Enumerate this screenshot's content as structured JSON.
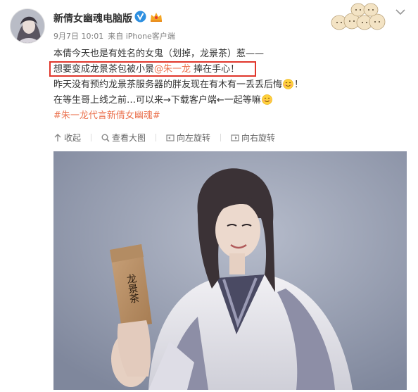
{
  "post": {
    "author": "新倩女幽魂电脑版",
    "date": "9月7日 10:01",
    "source": "来自 iPhone客户端",
    "lines": [
      "本倩今天也是有姓名的女鬼（划掉，龙景茶）惹——",
      "想要变成龙景茶包被小景",
      "@朱一龙",
      " 捧在手心！",
      "昨天没有预约龙景茶服务器的胖友现在有木有一丢丢后悔",
      "！",
      "在等生哥上线之前…可以来→下载客户端←一起等嘛",
      "#朱一龙代言新倩女幽魂#"
    ]
  },
  "toolbar": {
    "collapse": "收起",
    "view_large": "查看大图",
    "rotate_left": "向左旋转",
    "rotate_right": "向右旋转"
  },
  "photo": {
    "bag_text": "龙景茶"
  },
  "colors": {
    "link": "#eb7350",
    "highlight_border": "#e0362b",
    "verified": "#2d8fe0"
  },
  "icons": [
    "verified-badge-icon",
    "vip-crown-icon",
    "chevron-down-icon",
    "smile-emoji-icon",
    "collapse-icon",
    "magnify-icon",
    "rotate-left-icon",
    "rotate-right-icon"
  ]
}
